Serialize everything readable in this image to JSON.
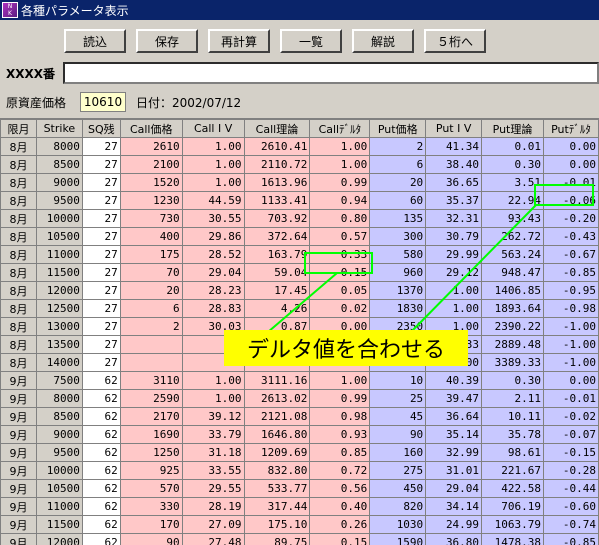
{
  "window": {
    "title": "各種パラメータ表示",
    "icon_text": "NIKKEI"
  },
  "toolbar": {
    "buttons": [
      "読込",
      "保存",
      "再計算",
      "一覧",
      "解説",
      "５桁へ"
    ]
  },
  "id_row": {
    "label": "XXXX番",
    "value": ""
  },
  "info": {
    "price_label": "原資産価格",
    "price_value": "10610",
    "date_text": "日付：2002/07/12"
  },
  "table": {
    "headers": [
      "限月",
      "Strike",
      "SQ残",
      "Call価格",
      "Call I V",
      "Call理論",
      "Callﾃﾞﾙﾀ",
      "Put価格",
      "Put I V",
      "Put理論",
      "Putﾃﾞﾙﾀ"
    ],
    "rows": [
      [
        "8月",
        "8000",
        "27",
        "2610",
        "1.00",
        "2610.41",
        "1.00",
        "2",
        "41.34",
        "0.01",
        "0.00"
      ],
      [
        "8月",
        "8500",
        "27",
        "2100",
        "1.00",
        "2110.72",
        "1.00",
        "6",
        "38.40",
        "0.30",
        "0.00"
      ],
      [
        "8月",
        "9000",
        "27",
        "1520",
        "1.00",
        "1613.96",
        "0.99",
        "20",
        "36.65",
        "3.51",
        "-0.01"
      ],
      [
        "8月",
        "9500",
        "27",
        "1230",
        "44.59",
        "1133.41",
        "0.94",
        "60",
        "35.37",
        "22.94",
        "-0.06"
      ],
      [
        "8月",
        "10000",
        "27",
        "730",
        "30.55",
        "703.92",
        "0.80",
        "135",
        "32.31",
        "93.43",
        "-0.20"
      ],
      [
        "8月",
        "10500",
        "27",
        "400",
        "29.86",
        "372.64",
        "0.57",
        "300",
        "30.79",
        "262.72",
        "-0.43"
      ],
      [
        "8月",
        "11000",
        "27",
        "175",
        "28.52",
        "163.79",
        "0.33",
        "580",
        "29.99",
        "563.24",
        "-0.67"
      ],
      [
        "8月",
        "11500",
        "27",
        "70",
        "29.04",
        "59.04",
        "0.15",
        "960",
        "29.12",
        "948.47",
        "-0.85"
      ],
      [
        "8月",
        "12000",
        "27",
        "20",
        "28.23",
        "17.45",
        "0.05",
        "1370",
        "1.00",
        "1406.85",
        "-0.95"
      ],
      [
        "8月",
        "12500",
        "27",
        "6",
        "28.83",
        "4.26",
        "0.02",
        "1830",
        "1.00",
        "1893.64",
        "-0.98"
      ],
      [
        "8月",
        "13000",
        "27",
        "2",
        "30.03",
        "0.87",
        "0.00",
        "2350",
        "1.00",
        "2390.22",
        "-1.00"
      ],
      [
        "8月",
        "13500",
        "27",
        "",
        "",
        "",
        "",
        "2910",
        "48.33",
        "2889.48",
        "-1.00"
      ],
      [
        "8月",
        "14000",
        "27",
        "",
        "",
        "",
        "",
        "3390",
        "1.00",
        "3389.33",
        "-1.00"
      ],
      [
        "9月",
        "7500",
        "62",
        "3110",
        "1.00",
        "3111.16",
        "1.00",
        "10",
        "40.39",
        "0.30",
        "0.00"
      ],
      [
        "9月",
        "8000",
        "62",
        "2590",
        "1.00",
        "2613.02",
        "0.99",
        "25",
        "39.47",
        "2.11",
        "-0.01"
      ],
      [
        "9月",
        "8500",
        "62",
        "2170",
        "39.12",
        "2121.08",
        "0.98",
        "45",
        "36.64",
        "10.11",
        "-0.02"
      ],
      [
        "9月",
        "9000",
        "62",
        "1690",
        "33.79",
        "1646.80",
        "0.93",
        "90",
        "35.14",
        "35.78",
        "-0.07"
      ],
      [
        "9月",
        "9500",
        "62",
        "1250",
        "31.18",
        "1209.69",
        "0.85",
        "160",
        "32.99",
        "98.61",
        "-0.15"
      ],
      [
        "9月",
        "10000",
        "62",
        "925",
        "33.55",
        "832.80",
        "0.72",
        "275",
        "31.01",
        "221.67",
        "-0.28"
      ],
      [
        "9月",
        "10500",
        "62",
        "570",
        "29.55",
        "533.77",
        "0.56",
        "450",
        "29.04",
        "422.58",
        "-0.44"
      ],
      [
        "9月",
        "11000",
        "62",
        "330",
        "28.19",
        "317.44",
        "0.40",
        "820",
        "34.14",
        "706.19",
        "-0.60"
      ],
      [
        "9月",
        "11500",
        "62",
        "170",
        "27.09",
        "175.10",
        "0.26",
        "1030",
        "24.99",
        "1063.79",
        "-0.74"
      ],
      [
        "9月",
        "12000",
        "62",
        "90",
        "27.48",
        "89.75",
        "0.15",
        "1590",
        "36.80",
        "1478.38",
        "-0.85"
      ],
      [
        "9月",
        "12500",
        "62",
        "40",
        "27.01",
        "42.90",
        "0.08",
        "2010",
        "24.84",
        "1931.47",
        "-0.92"
      ]
    ]
  },
  "annotation": {
    "text": "デルタ値を合わせる",
    "color": "#00ff00",
    "background": "#ffff00"
  },
  "colors": {
    "call_bg": "#ffc8c8",
    "put_bg": "#c8c8ff",
    "title_bg": "#0a246a"
  }
}
